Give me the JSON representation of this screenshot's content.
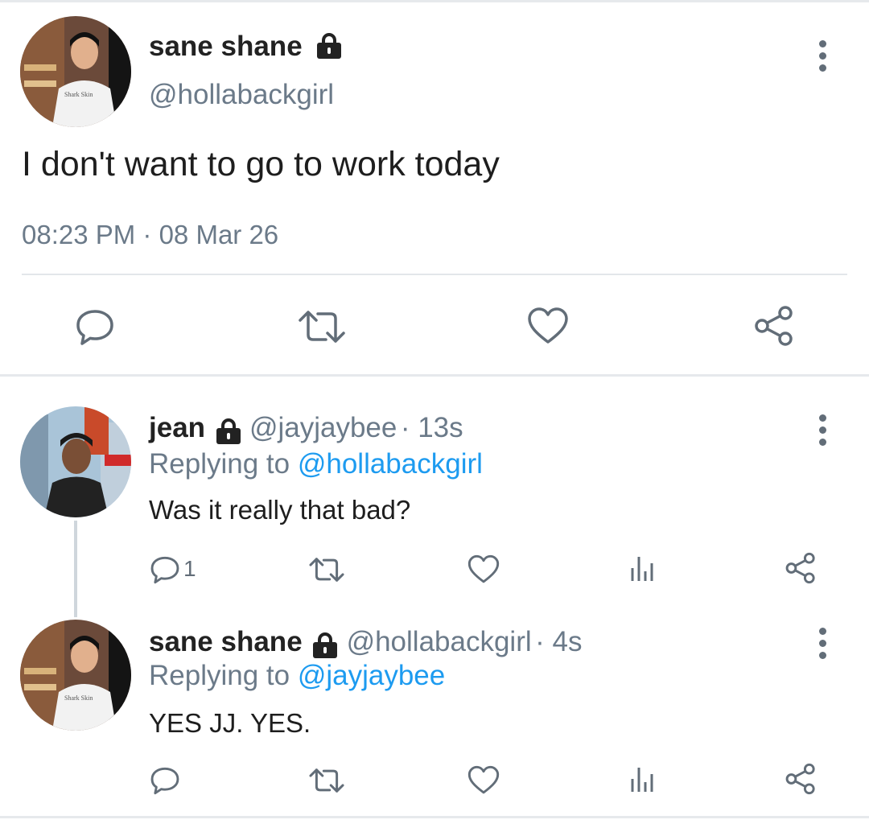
{
  "main_tweet": {
    "author_name": "sane shane",
    "author_handle": "@hollabackgirl",
    "text": "I don't want to go to work today",
    "timestamp": "08:23 PM · 08 Mar 26",
    "icons": [
      "reply-icon",
      "retweet-icon",
      "like-icon",
      "share-icon",
      "lock-icon",
      "more-options-icon"
    ]
  },
  "replies": [
    {
      "author_name": "jean",
      "author_handle": "@jayjaybee",
      "time": "· 13s",
      "replying_prefix": "Replying to ",
      "replying_to": "@hollabackgirl",
      "text": "Was it really that bad?",
      "reply_count": "1"
    },
    {
      "author_name": "sane shane",
      "author_handle": "@hollabackgirl",
      "time": "· 4s",
      "replying_prefix": "Replying to ",
      "replying_to": "@jayjaybee",
      "text": "YES JJ. YES.",
      "reply_count": ""
    }
  ],
  "colors": {
    "link": "#1d9bf0",
    "muted": "#6b7a89",
    "icon": "#626d78"
  }
}
